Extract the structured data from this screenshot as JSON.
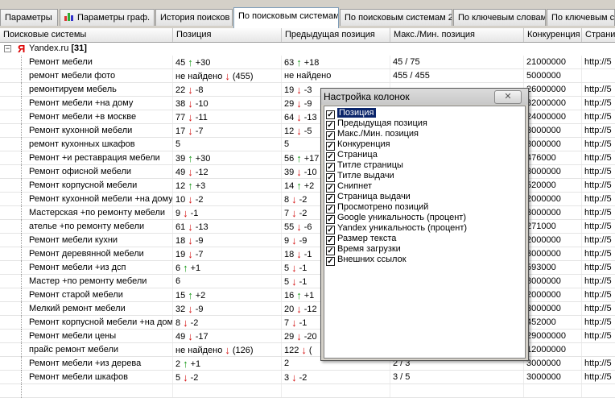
{
  "tabs": [
    {
      "label": "Параметры",
      "active": false
    },
    {
      "label": "Параметры граф.",
      "active": false,
      "icon": "bar-chart-icon"
    },
    {
      "label": "История поисков",
      "active": false
    },
    {
      "label": "По поисковым системам",
      "active": true
    },
    {
      "label": "По поисковым системам 2",
      "active": false
    },
    {
      "label": "По ключевым словам",
      "active": false
    },
    {
      "label": "По ключевым сл",
      "active": false
    }
  ],
  "columns": [
    "Поисковые системы",
    "Позиция",
    "Предыдущая позиция",
    "Макс./Мин. позиция",
    "Конкуренция",
    "Страни"
  ],
  "group": {
    "expander": "−",
    "logo": "Я",
    "name": "Yandex.ru",
    "count": "[31]"
  },
  "rows": [
    {
      "q": "Ремонт мебели",
      "p": "45",
      "pd": "up",
      "pc": "+30",
      "pp": "63",
      "ppd": "up",
      "ppc": "+18",
      "mm": "45 / 75",
      "k": "21000000",
      "s": "http://5"
    },
    {
      "q": "ремонт мебели фото",
      "p": "не найдено",
      "pd": "down",
      "pc": "(455)",
      "pp": "не найдено",
      "ppd": "",
      "ppc": "",
      "mm": "455 / 455",
      "k": "5000000",
      "s": ""
    },
    {
      "q": "ремонтируем мебель",
      "p": "22",
      "pd": "down",
      "pc": "-8",
      "pp": "19",
      "ppd": "down",
      "ppc": "-3",
      "mm": "",
      "k": "26000000",
      "s": "http://5"
    },
    {
      "q": "Ремонт мебели +на дому",
      "p": "38",
      "pd": "down",
      "pc": "-10",
      "pp": "29",
      "ppd": "down",
      "ppc": "-9",
      "mm": "",
      "k": "32000000",
      "s": "http://5"
    },
    {
      "q": "Ремонт мебели +в москве",
      "p": "77",
      "pd": "down",
      "pc": "-11",
      "pp": "64",
      "ppd": "down",
      "ppc": "-13",
      "mm": "",
      "k": "24000000",
      "s": "http://5"
    },
    {
      "q": "Ремонт кухонной мебели",
      "p": "17",
      "pd": "down",
      "pc": "-7",
      "pp": "12",
      "ppd": "down",
      "ppc": "-5",
      "mm": "",
      "k": "3000000",
      "s": "http://5"
    },
    {
      "q": "ремонт кухонных шкафов",
      "p": "5",
      "pd": "",
      "pc": "",
      "pp": "5",
      "ppd": "",
      "ppc": "",
      "mm": "",
      "k": "3000000",
      "s": "http://5"
    },
    {
      "q": "Ремонт +и реставрация мебели",
      "p": "39",
      "pd": "up",
      "pc": "+30",
      "pp": "56",
      "ppd": "up",
      "ppc": "+17",
      "mm": "",
      "k": "476000",
      "s": "http://5"
    },
    {
      "q": "Ремонт офисной мебели",
      "p": "49",
      "pd": "down",
      "pc": "-12",
      "pp": "39",
      "ppd": "down",
      "ppc": "-10",
      "mm": "",
      "k": "3000000",
      "s": "http://5"
    },
    {
      "q": "Ремонт корпусной мебели",
      "p": "12",
      "pd": "up",
      "pc": "+3",
      "pp": "14",
      "ppd": "up",
      "ppc": "+2",
      "mm": "",
      "k": "520000",
      "s": "http://5"
    },
    {
      "q": "Ремонт кухонной мебели +на дому",
      "p": "10",
      "pd": "down",
      "pc": "-2",
      "pp": "8",
      "ppd": "down",
      "ppc": "-2",
      "mm": "",
      "k": "2000000",
      "s": "http://5"
    },
    {
      "q": "Мастерская +по ремонту мебели",
      "p": "9",
      "pd": "down",
      "pc": "-1",
      "pp": "7",
      "ppd": "down",
      "ppc": "-2",
      "mm": "",
      "k": "3000000",
      "s": "http://5"
    },
    {
      "q": "ателье +по ремонту мебели",
      "p": "61",
      "pd": "down",
      "pc": "-13",
      "pp": "55",
      "ppd": "down",
      "ppc": "-6",
      "mm": "",
      "k": "271000",
      "s": "http://5"
    },
    {
      "q": "Ремонт мебели кухни",
      "p": "18",
      "pd": "down",
      "pc": "-9",
      "pp": "9",
      "ppd": "down",
      "ppc": "-9",
      "mm": "",
      "k": "2000000",
      "s": "http://5"
    },
    {
      "q": "Ремонт деревянной мебели",
      "p": "19",
      "pd": "down",
      "pc": "-7",
      "pp": "18",
      "ppd": "down",
      "ppc": "-1",
      "mm": "",
      "k": "3000000",
      "s": "http://5"
    },
    {
      "q": "Ремонт мебели +из дсп",
      "p": "6",
      "pd": "up",
      "pc": "+1",
      "pp": "5",
      "ppd": "down",
      "ppc": "-1",
      "mm": "",
      "k": "593000",
      "s": "http://5"
    },
    {
      "q": "Мастер +по ремонту мебели",
      "p": "6",
      "pd": "",
      "pc": "",
      "pp": "5",
      "ppd": "down",
      "ppc": "-1",
      "mm": "",
      "k": "3000000",
      "s": "http://5"
    },
    {
      "q": "Ремонт старой мебели",
      "p": "15",
      "pd": "up",
      "pc": "+2",
      "pp": "16",
      "ppd": "up",
      "ppc": "+1",
      "mm": "",
      "k": "2000000",
      "s": "http://5"
    },
    {
      "q": "Мелкий ремонт мебели",
      "p": "32",
      "pd": "down",
      "pc": "-9",
      "pp": "20",
      "ppd": "down",
      "ppc": "-12",
      "mm": "",
      "k": "3000000",
      "s": "http://5"
    },
    {
      "q": "Ремонт корпусной мебели +на дому",
      "p": "8",
      "pd": "down",
      "pc": "-2",
      "pp": "7",
      "ppd": "down",
      "ppc": "-1",
      "mm": "",
      "k": "452000",
      "s": "http://5"
    },
    {
      "q": "Ремонт мебели цены",
      "p": "49",
      "pd": "down",
      "pc": "-17",
      "pp": "29",
      "ppd": "down",
      "ppc": "-20",
      "mm": "",
      "k": "29000000",
      "s": "http://5"
    },
    {
      "q": "прайс ремонт мебели",
      "p": "не найдено",
      "pd": "down",
      "pc": "(126)",
      "pp": "122",
      "ppd": "down",
      "ppc": "(",
      "mm": "",
      "k": "12000000",
      "s": ""
    },
    {
      "q": "Ремонт мебели +из дерева",
      "p": "2",
      "pd": "up",
      "pc": "+1",
      "pp": "2",
      "ppd": "",
      "ppc": "",
      "mm": "2 / 3",
      "k": "3000000",
      "s": "http://5"
    },
    {
      "q": "Ремонт мебели шкафов",
      "p": "5",
      "pd": "down",
      "pc": "-2",
      "pp": "3",
      "ppd": "down",
      "ppc": "-2",
      "mm": "3 / 5",
      "k": "3000000",
      "s": "http://5"
    },
    {
      "q": "",
      "p": "",
      "pd": "",
      "pc": "",
      "pp": "",
      "ppd": "",
      "ppc": "",
      "mm": "",
      "k": "",
      "s": ""
    }
  ],
  "dialog": {
    "title": "Настройка колонок",
    "close_label": "✕",
    "options": [
      {
        "label": "Позиция",
        "checked": true,
        "selected": true
      },
      {
        "label": "Предыдущая позиция",
        "checked": true
      },
      {
        "label": "Макс./Мин. позиция",
        "checked": true
      },
      {
        "label": "Конкуренция",
        "checked": true
      },
      {
        "label": "Страница",
        "checked": true
      },
      {
        "label": "Титле страницы",
        "checked": true
      },
      {
        "label": "Титле выдачи",
        "checked": true
      },
      {
        "label": "Снипнет",
        "checked": true
      },
      {
        "label": "Страница выдачи",
        "checked": true
      },
      {
        "label": "Просмотрено позиций",
        "checked": true
      },
      {
        "label": "Google уникальность (процент)",
        "checked": true
      },
      {
        "label": "Yandex уникальность (процент)",
        "checked": true
      },
      {
        "label": "Размер текста",
        "checked": true
      },
      {
        "label": "Время загрузки",
        "checked": true
      },
      {
        "label": "Внешних ссылок",
        "checked": true
      }
    ]
  }
}
